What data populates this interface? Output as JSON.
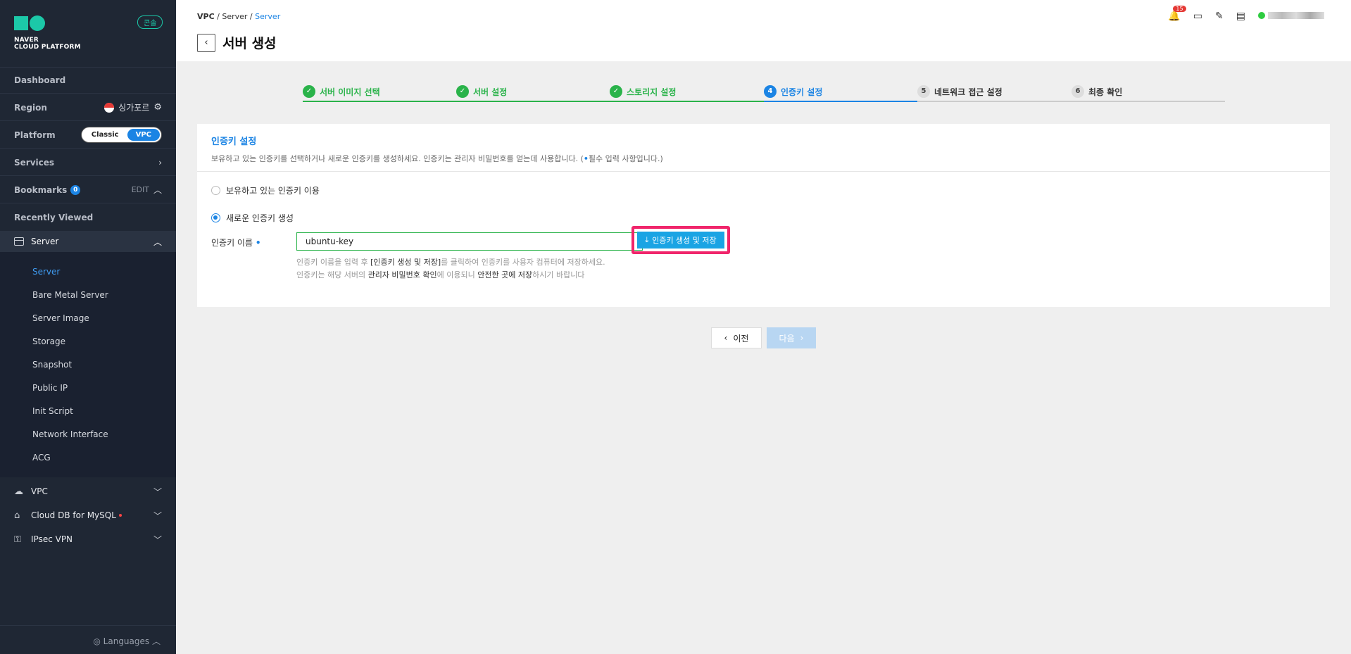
{
  "sidebar": {
    "logo_line1": "NAVER",
    "logo_line2": "CLOUD PLATFORM",
    "console_badge": "콘솔",
    "dashboard": "Dashboard",
    "region_label": "Region",
    "region_value": "싱가포르",
    "platform_label": "Platform",
    "platform_options": [
      "Classic",
      "VPC"
    ],
    "services": "Services",
    "bookmarks": "Bookmarks",
    "bookmarks_count": "0",
    "edit": "EDIT",
    "recently_viewed": "Recently Viewed",
    "server_group": "Server",
    "server_items": [
      "Server",
      "Bare Metal Server",
      "Server Image",
      "Storage",
      "Snapshot",
      "Public IP",
      "Init Script",
      "Network Interface",
      "ACG"
    ],
    "groups": [
      "VPC",
      "Cloud DB for MySQL",
      "IPsec VPN"
    ],
    "languages": "Languages"
  },
  "header": {
    "breadcrumb": [
      "VPC",
      "Server",
      "Server"
    ],
    "title": "서버 생성",
    "notification_count": "15"
  },
  "steps": [
    {
      "num": "1",
      "label": "서버 이미지 선택",
      "state": "done"
    },
    {
      "num": "2",
      "label": "서버 설정",
      "state": "done"
    },
    {
      "num": "3",
      "label": "스토리지 설정",
      "state": "done"
    },
    {
      "num": "4",
      "label": "인증키 설정",
      "state": "current"
    },
    {
      "num": "5",
      "label": "네트워크 접근 설정",
      "state": "todo"
    },
    {
      "num": "6",
      "label": "최종 확인",
      "state": "todo"
    }
  ],
  "card": {
    "title": "인증키 설정",
    "desc_before": "보유하고 있는 인증키를 선택하거나 새로운 인증키를 생성하세요. 인증키는 관리자 비밀번호를 얻는데 사용합니다. (",
    "desc_after": "필수 입력 사항입니다.)",
    "radio_existing": "보유하고 있는 인증키 이용",
    "radio_new": "새로운 인증키 생성",
    "field_label": "인증키 이름",
    "input_value": "ubuntu-key",
    "create_button": "인증키 생성 및 저장",
    "help1_a": "인증키 이름을 입력 후 ",
    "help1_b": "[인증키 생성 및 저장]",
    "help1_c": "를 클릭하여 인증키를 사용자 컴퓨터에 저장하세요.",
    "help2_a": "인증키는 해당 서버의 ",
    "help2_b": "관리자 비밀번호 확인",
    "help2_c": "에 이용되니 ",
    "help2_d": "안전한 곳에 저장",
    "help2_e": "하시기 바랍니다"
  },
  "nav": {
    "prev": "이전",
    "next": "다음"
  }
}
